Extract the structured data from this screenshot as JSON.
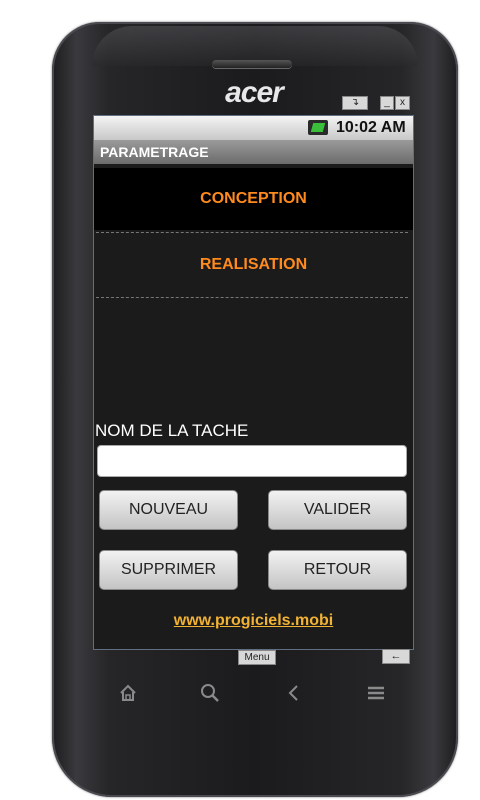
{
  "device": {
    "brand": "acer",
    "emulator_buttons": {
      "rotate": "↴",
      "minimize": "_",
      "close": "x"
    },
    "menu_label": "Menu",
    "back_icon": "←"
  },
  "status_bar": {
    "time": "10:02 AM"
  },
  "app": {
    "title": "PARAMETRAGE",
    "list_items": [
      {
        "label": "CONCEPTION"
      },
      {
        "label": "REALISATION"
      }
    ],
    "task_label": "NOM DE LA TACHE",
    "task_input": {
      "value": "",
      "placeholder": ""
    },
    "buttons": {
      "nouveau": "NOUVEAU",
      "valider": "VALIDER",
      "supprimer": "SUPPRIMER",
      "retour": "RETOUR"
    },
    "link": "www.progiciels.mobi"
  },
  "nav_icons": [
    "home-icon",
    "search-icon",
    "back-icon",
    "menu-icon"
  ],
  "colors": {
    "accent": "#ff8a1e",
    "link": "#f2b234",
    "screen_bg": "#1b1b1b"
  }
}
